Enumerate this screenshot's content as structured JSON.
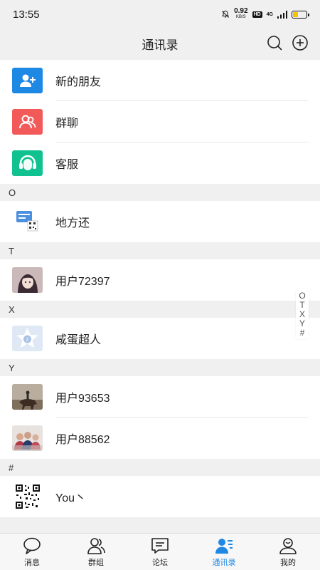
{
  "status": {
    "time": "13:55",
    "speed": "0.92",
    "speed_unit": "KB/S",
    "network": "4G",
    "hd": "HD"
  },
  "header": {
    "title": "通讯录",
    "icons": [
      "search-icon",
      "add-circle-icon"
    ]
  },
  "top_items": [
    {
      "label": "新的朋友",
      "icon": "add-friend-icon",
      "color": "#1e88e5"
    },
    {
      "label": "群聊",
      "icon": "group-chat-icon",
      "color": "#f25a5a"
    },
    {
      "label": "客服",
      "icon": "headset-icon",
      "color": "#10c28f"
    }
  ],
  "sections": [
    {
      "letter": "O",
      "contacts": [
        {
          "name": "地方还",
          "avatar": "qr-card-avatar"
        }
      ]
    },
    {
      "letter": "T",
      "contacts": [
        {
          "name": "用户72397",
          "avatar": "anime-girl-avatar"
        }
      ]
    },
    {
      "letter": "X",
      "contacts": [
        {
          "name": "咸蛋超人",
          "avatar": "default-star-avatar"
        }
      ]
    },
    {
      "letter": "Y",
      "contacts": [
        {
          "name": "用户93653",
          "avatar": "horse-rider-avatar"
        },
        {
          "name": "用户88562",
          "avatar": "family-photo-avatar"
        }
      ]
    },
    {
      "letter": "#",
      "contacts": [
        {
          "name": "You丶",
          "avatar": "qr-code-avatar"
        }
      ]
    }
  ],
  "index_bar": [
    "O",
    "T",
    "X",
    "Y",
    "#"
  ],
  "tabs": [
    {
      "label": "消息",
      "icon": "chat-bubble-icon",
      "active": false
    },
    {
      "label": "群组",
      "icon": "group-icon",
      "active": false
    },
    {
      "label": "论坛",
      "icon": "forum-icon",
      "active": false
    },
    {
      "label": "通讯录",
      "icon": "contacts-icon",
      "active": true
    },
    {
      "label": "我的",
      "icon": "profile-icon",
      "active": false
    }
  ],
  "colors": {
    "accent": "#1e88e5",
    "background": "#f0f0f0"
  }
}
